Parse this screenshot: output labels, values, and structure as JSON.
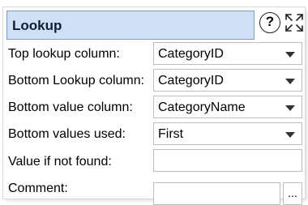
{
  "panel": {
    "title": "Lookup",
    "help_glyph": "?",
    "help_icon": "question-circle-icon",
    "fullscreen_icon": "expand-arrows-icon"
  },
  "rows": {
    "top_lookup": {
      "label": "Top lookup column:",
      "value": "CategoryID"
    },
    "bottom_lookup": {
      "label": "Bottom Lookup column:",
      "value": "CategoryID"
    },
    "bottom_value": {
      "label": "Bottom value column:",
      "value": "CategoryName"
    },
    "bottom_used": {
      "label": "Bottom values used:",
      "value": "First"
    },
    "not_found": {
      "label": "Value if not found:",
      "value": ""
    },
    "comment": {
      "label": "Comment:",
      "value": "",
      "button": "..."
    }
  },
  "colors": {
    "title_bg": "#cfe0f5",
    "title_border": "#7a9cc6"
  }
}
